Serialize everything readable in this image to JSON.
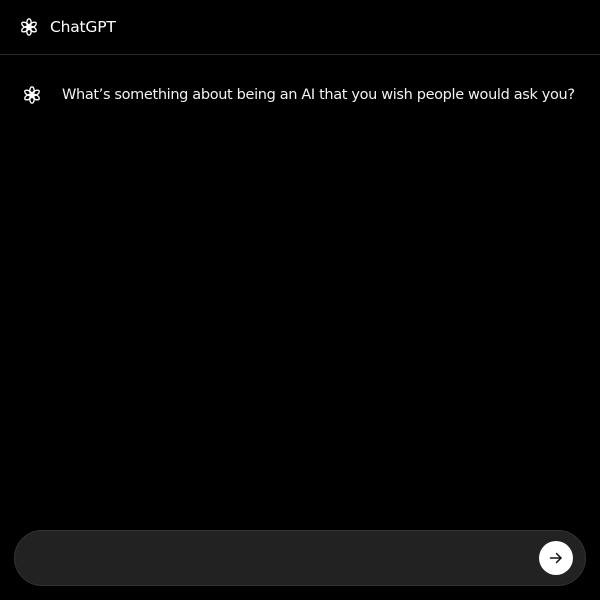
{
  "header": {
    "logo_icon": "openai-logo-icon",
    "title": "ChatGPT"
  },
  "message": {
    "avatar_icon": "openai-logo-icon",
    "text": "What’s something about being an AI that you wish people would ask you?"
  },
  "composer": {
    "input_value": "",
    "send_icon": "arrow-right-icon"
  },
  "colors": {
    "background": "#000000",
    "text": "#ffffff",
    "composer_background": "#222222",
    "send_button": "#ffffff",
    "divider": "#2a2a2a"
  }
}
